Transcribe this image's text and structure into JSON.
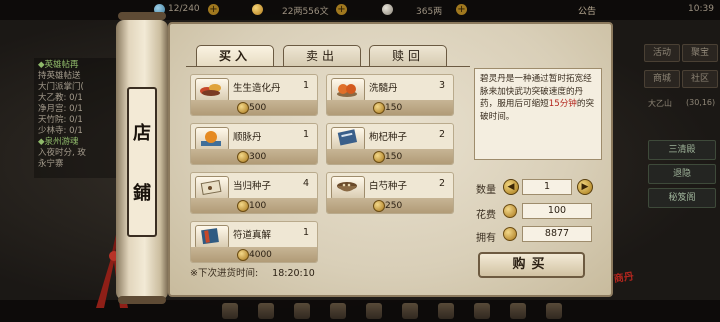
{
  "topbar": {
    "energy": "12/240",
    "copper": "22两556文",
    "silver": "365两",
    "announcement": "公告",
    "clock": "10:39"
  },
  "quest_panel": {
    "line1": "◆英雄帖再",
    "line2": "持英雄帖送",
    "line3": "大门派掌门(",
    "line4": "大乙教: 0/1",
    "line5": "净月宫: 0/1",
    "line6": "天竹院: 0/1",
    "line7": "少林寺: 0/1",
    "line8": "◆泉州游魂",
    "line9": "入夜时分, 玫",
    "line10": "永宁寨"
  },
  "right_menu": {
    "btn1": "活动",
    "btn2": "聚宝",
    "btn3": "商城",
    "btn4": "社区",
    "area_name": "大乙山",
    "area_coords": "(30,16)",
    "btn_wide1": "三清殿",
    "btn_wide2": "退隐",
    "btn_wide3": "秘笈阁"
  },
  "shop": {
    "title_char1": "店",
    "title_char2": "鋪",
    "tabs": [
      "买入",
      "卖出",
      "赎回"
    ],
    "active_tab": "买入",
    "items": [
      {
        "name": "生生造化丹",
        "qty": "1",
        "price": "500",
        "icon": "pill-pile-icon"
      },
      {
        "name": "洗髓丹",
        "qty": "3",
        "price": "150",
        "icon": "orange-pill-icon"
      },
      {
        "name": "顺脉丹",
        "qty": "1",
        "price": "300",
        "icon": "orange-ball-icon"
      },
      {
        "name": "枸杞种子",
        "qty": "2",
        "price": "150",
        "icon": "seed-book-icon"
      },
      {
        "name": "当归种子",
        "qty": "4",
        "price": "100",
        "icon": "seed-pack-icon"
      },
      {
        "name": "白芍种子",
        "qty": "2",
        "price": "250",
        "icon": "seed-bowl-icon"
      },
      {
        "name": "符道真解",
        "qty": "1",
        "price": "4000",
        "icon": "scripture-book-icon"
      }
    ],
    "restock_label": "※下次进货时间:",
    "restock_time": "18:20:10",
    "description_pre": "碧灵丹是一种通过暂时拓宽经脉来加快武功突破速度的丹药，服用后可缩短",
    "description_highlight": "15分钟",
    "description_post": "的突破时间。",
    "quantity_label": "数量",
    "quantity_value": "1",
    "cost_label": "花费",
    "cost_value": "100",
    "owned_label": "拥有",
    "owned_value": "8877",
    "buy_button": "购买",
    "seal": "商丹"
  }
}
